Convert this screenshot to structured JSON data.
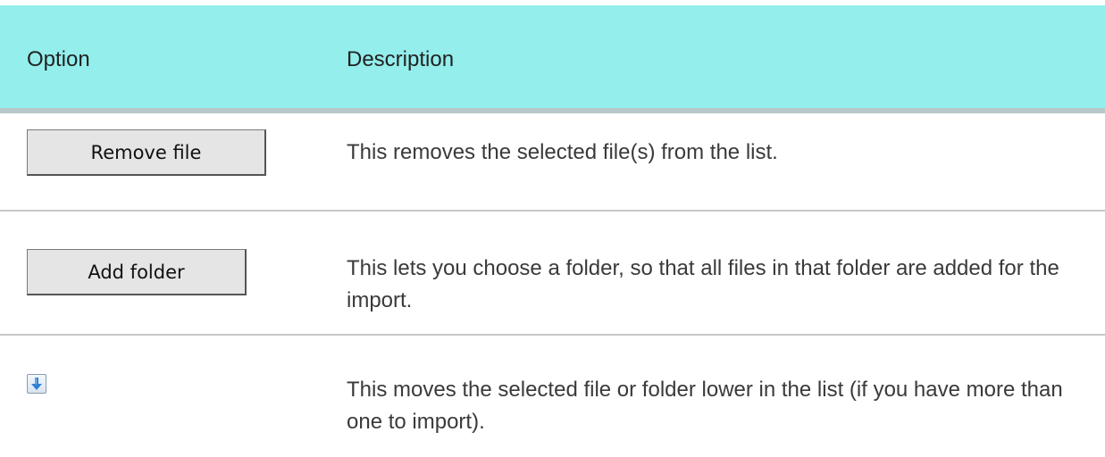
{
  "table": {
    "header": {
      "option": "Option",
      "description": "Description"
    },
    "rows": [
      {
        "option_label": "Remove file",
        "description": "This removes the selected file(s) from the list."
      },
      {
        "option_label": "Add folder",
        "description": "This lets you choose a folder, so that all files in that folder are added for the import."
      },
      {
        "option_icon": "arrow-down-icon",
        "description": "This moves the selected file or folder lower in the list (if you have more than one to import)."
      }
    ]
  },
  "colors": {
    "header_background": "#93eeec",
    "header_border": "#b8c8c8",
    "row_divider": "#c8c8c8",
    "button_background": "#e5e5e5",
    "arrow_icon": "#2f7fd6"
  }
}
